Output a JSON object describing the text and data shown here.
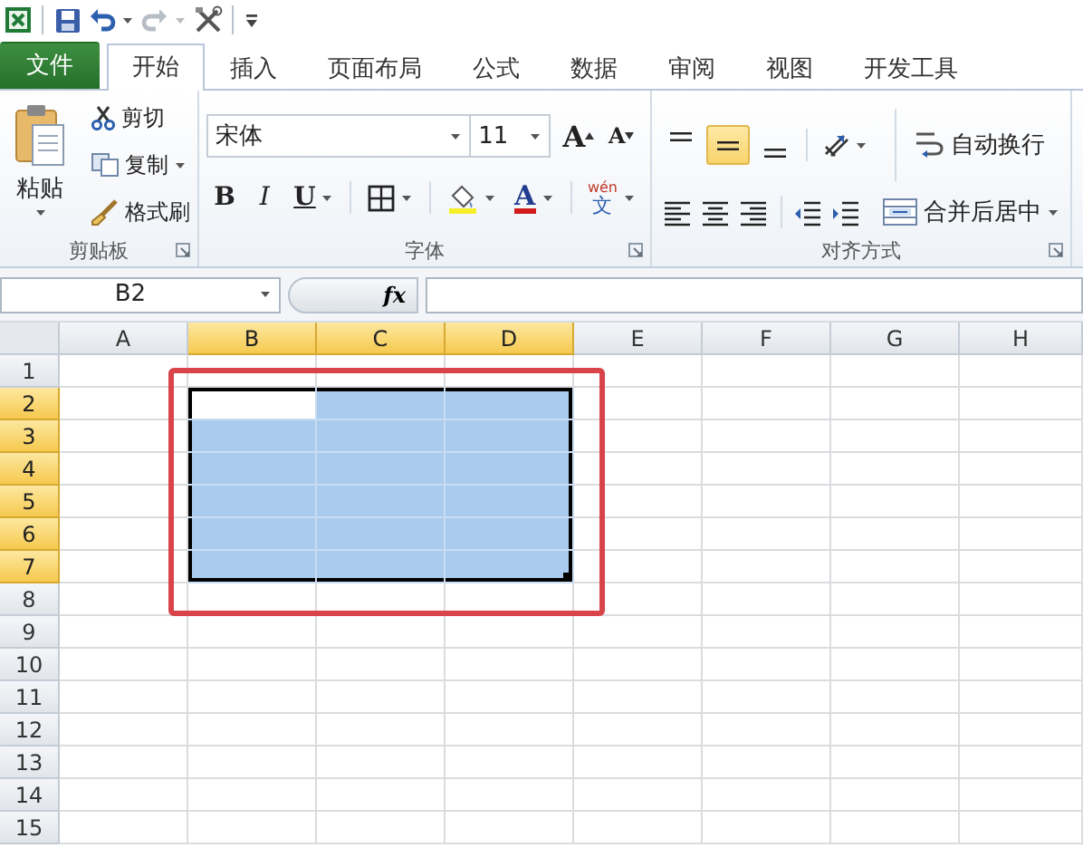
{
  "quick_access": [
    {
      "kind": "excel",
      "disabled": false
    },
    {
      "kind": "save",
      "disabled": false
    },
    {
      "kind": "undo",
      "disabled": false
    },
    {
      "kind": "redo",
      "disabled": true
    },
    {
      "kind": "tools",
      "disabled": false
    },
    {
      "kind": "customize",
      "disabled": false
    }
  ],
  "tabs": [
    {
      "label": "文件",
      "kind": "file",
      "selected": false
    },
    {
      "label": "开始",
      "kind": "tab",
      "selected": true
    },
    {
      "label": "插入",
      "kind": "tab",
      "selected": false
    },
    {
      "label": "页面布局",
      "kind": "tab",
      "selected": false
    },
    {
      "label": "公式",
      "kind": "tab",
      "selected": false
    },
    {
      "label": "数据",
      "kind": "tab",
      "selected": false
    },
    {
      "label": "审阅",
      "kind": "tab",
      "selected": false
    },
    {
      "label": "视图",
      "kind": "tab",
      "selected": false
    },
    {
      "label": "开发工具",
      "kind": "tab",
      "selected": false
    }
  ],
  "ribbon": {
    "clipboard": {
      "title": "剪贴板",
      "paste": "粘贴",
      "cut": "剪切",
      "copy": "复制",
      "format_painter": "格式刷"
    },
    "font": {
      "title": "字体",
      "font_name": "宋体",
      "font_size": "11",
      "grow": "A",
      "shrink": "A",
      "bold": "B",
      "italic": "I",
      "underline": "U",
      "font_color": "A",
      "phonetic_top": "wén",
      "phonetic_char": "文"
    },
    "alignment": {
      "title": "对齐方式",
      "vertical": [
        {
          "kind": "top",
          "selected": false
        },
        {
          "kind": "middle",
          "selected": true
        },
        {
          "kind": "bottom",
          "selected": false
        }
      ],
      "wrap_text": "自动换行",
      "merge_center": "合并后居中"
    }
  },
  "formula_bar": {
    "name_box": "B2",
    "fx": "fx"
  },
  "sheet": {
    "columns": [
      {
        "label": "A",
        "selected": false
      },
      {
        "label": "B",
        "selected": true
      },
      {
        "label": "C",
        "selected": true
      },
      {
        "label": "D",
        "selected": true
      },
      {
        "label": "E",
        "selected": false
      },
      {
        "label": "F",
        "selected": false
      },
      {
        "label": "G",
        "selected": false
      },
      {
        "label": "H",
        "selected": false
      }
    ],
    "rows": [
      {
        "label": "1",
        "selected": false
      },
      {
        "label": "2",
        "selected": true
      },
      {
        "label": "3",
        "selected": true
      },
      {
        "label": "4",
        "selected": true
      },
      {
        "label": "5",
        "selected": true
      },
      {
        "label": "6",
        "selected": true
      },
      {
        "label": "7",
        "selected": true
      },
      {
        "label": "8",
        "selected": false
      },
      {
        "label": "9",
        "selected": false
      },
      {
        "label": "10",
        "selected": false
      },
      {
        "label": "11",
        "selected": false
      },
      {
        "label": "12",
        "selected": false
      },
      {
        "label": "13",
        "selected": false
      },
      {
        "label": "14",
        "selected": false
      },
      {
        "label": "15",
        "selected": false
      }
    ],
    "highlight_box": true
  }
}
